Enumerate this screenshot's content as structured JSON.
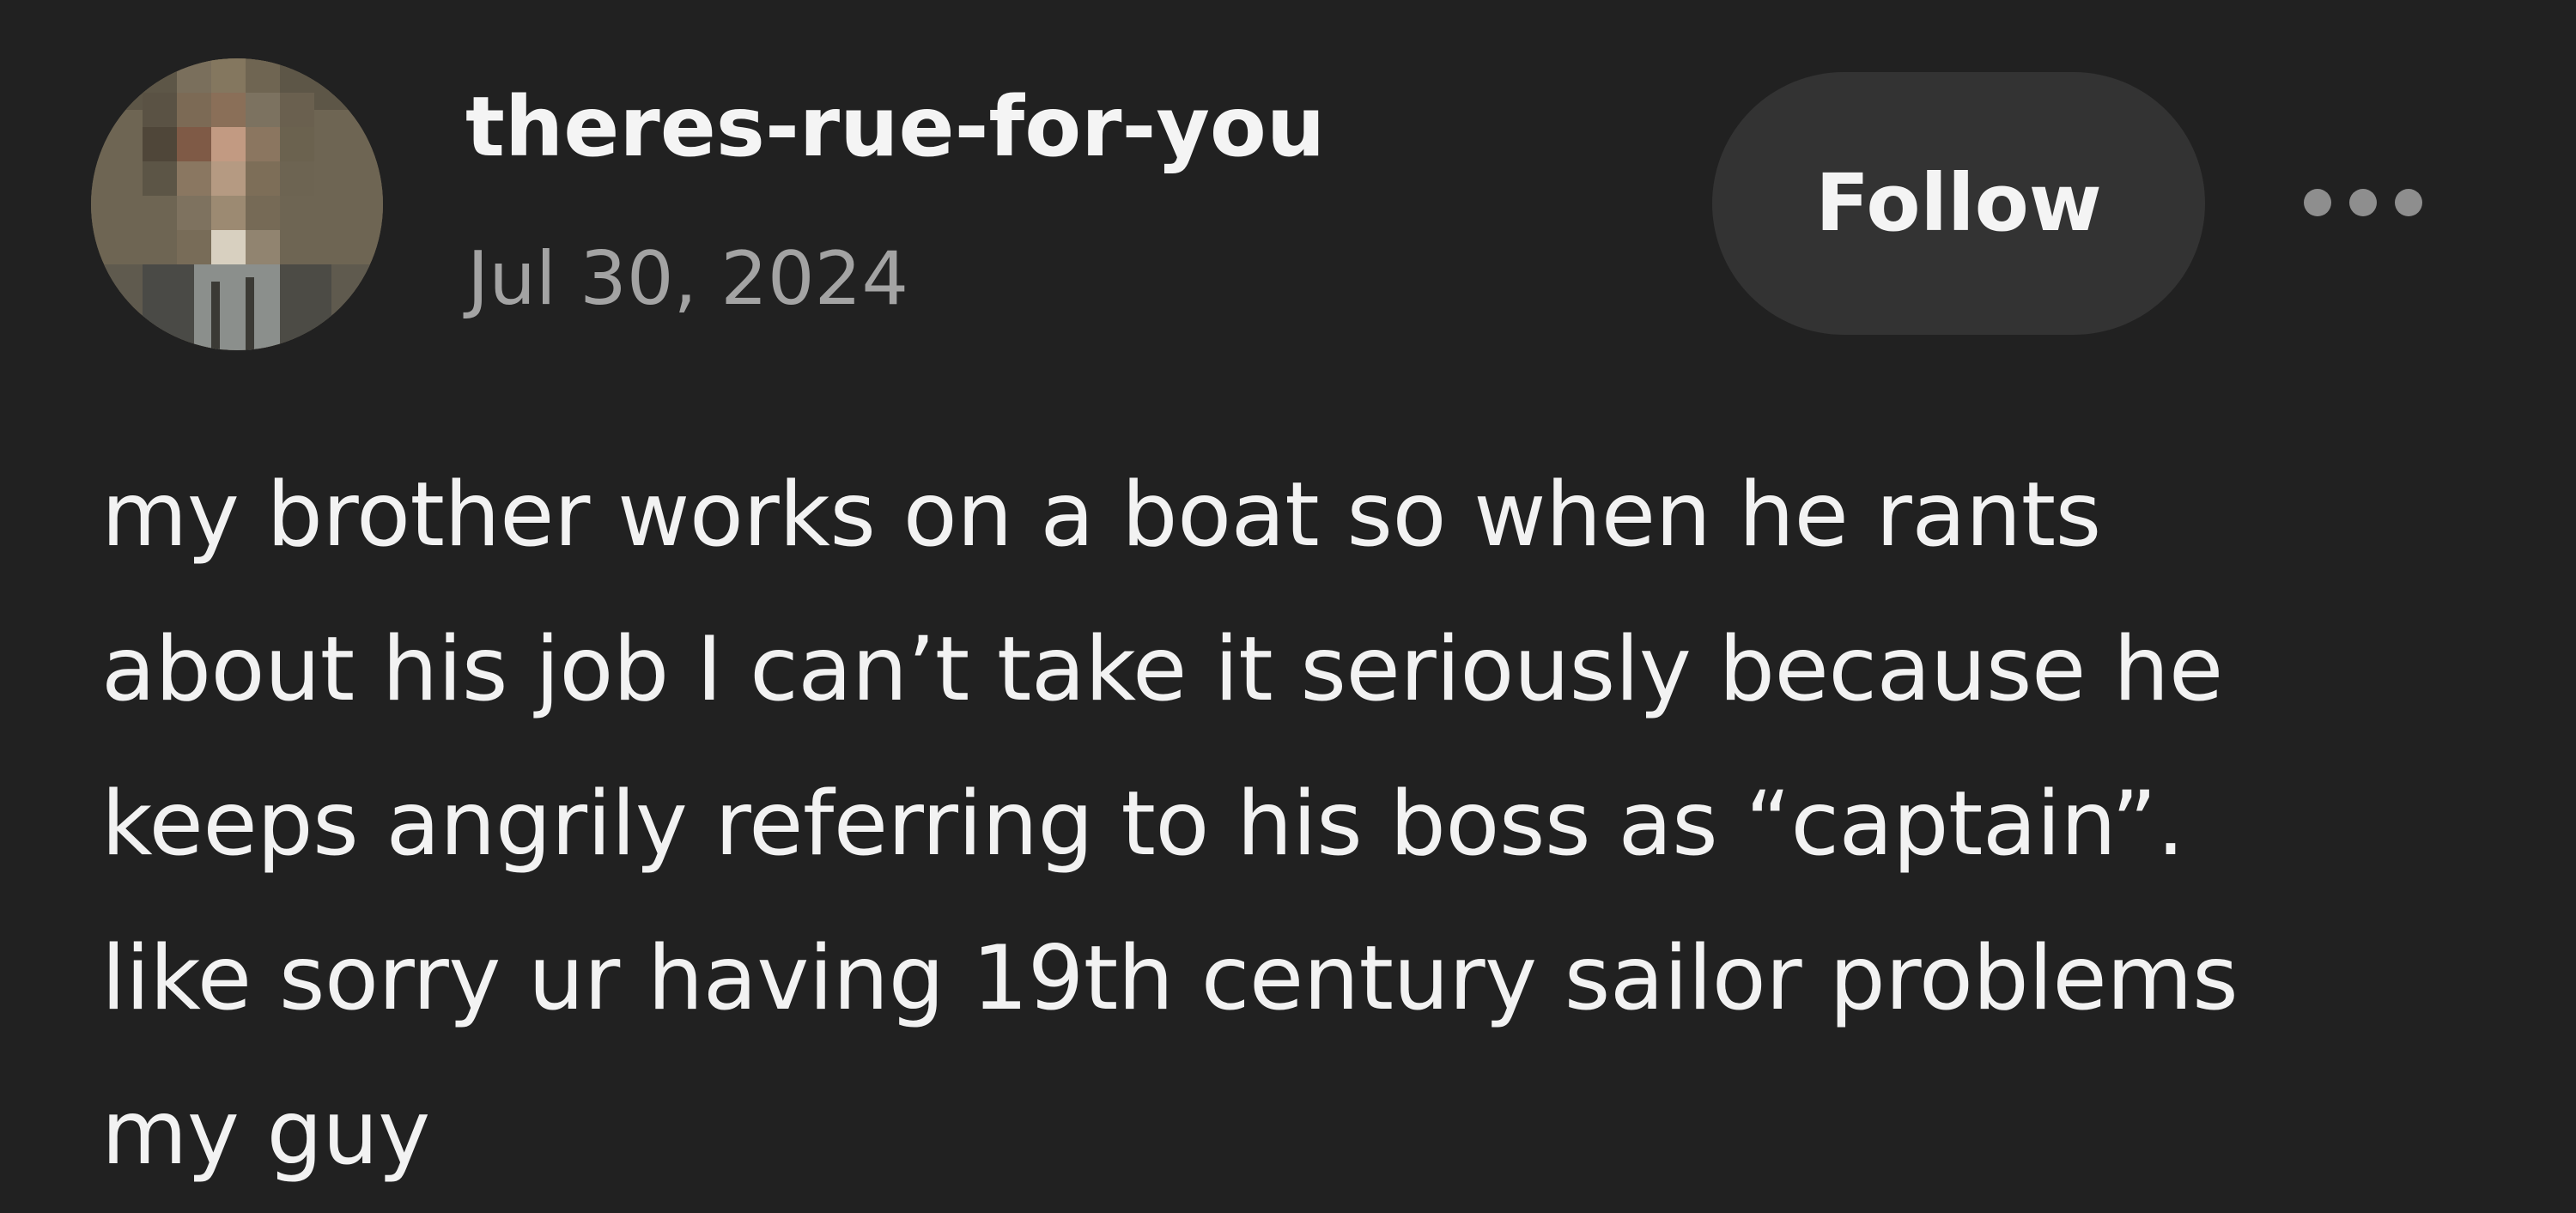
{
  "post": {
    "author": {
      "username": "theres-rue-for-you",
      "avatar_icon": "blurred-profile-avatar"
    },
    "date": "Jul 30, 2024",
    "follow_label": "Follow",
    "more_icon": "ellipsis-icon",
    "body_lines": [
      "my brother works on a boat so when he rants",
      "about his job I can’t take it seriously because he",
      "keeps angrily referring to his boss as “captain”.",
      "like sorry ur having 19th century sailor problems",
      "my guy"
    ]
  },
  "colors": {
    "background": "#212121",
    "text_primary": "#f2f2f2",
    "text_secondary": "#a3a3a3",
    "button_bg": "#333333"
  }
}
